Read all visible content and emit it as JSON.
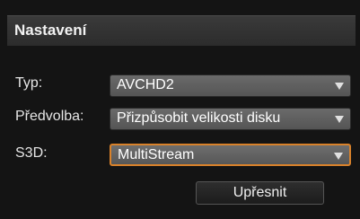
{
  "panel": {
    "title": "Nastavení"
  },
  "rows": [
    {
      "label": "Typ:",
      "value": "AVCHD2"
    },
    {
      "label": "Předvolba:",
      "value": "Přizpůsobit velikosti disku"
    },
    {
      "label": "S3D:",
      "value": "MultiStream"
    }
  ],
  "actions": {
    "refine_label": "Upřesnit"
  },
  "colors": {
    "focus_border": "#d9822b"
  },
  "icons": {
    "dropdown": "chevron-down-icon"
  }
}
